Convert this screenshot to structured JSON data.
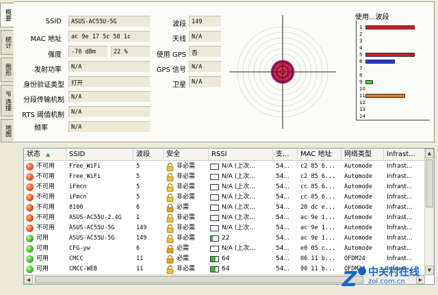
{
  "tabs": [
    "概要",
    "统计",
    "图形",
    "IP 连接",
    "地图"
  ],
  "info": {
    "ssid_label": "SSID",
    "ssid": "ASUS-AC55U-5G",
    "mac_label": "MAC 地址",
    "mac": "ac 9e 17 5c 58 1c",
    "strength_label": "强度",
    "strength_dbm": "-78 dBm",
    "strength_pct": "22 %",
    "tx_label": "发射功率",
    "tx": "N/A",
    "auth_label": "身份验证类型",
    "auth": "打开",
    "frag_label": "分段传输机制",
    "frag": "N/A",
    "rts_label": "RTS 阈值机制",
    "rts": "N/A",
    "freq_label": "频率",
    "freq": "N/A",
    "channel_label": "波段",
    "channel": "149",
    "antenna_label": "天线",
    "antenna": "N/A",
    "gps_label": "使用 GPS",
    "gps": "否",
    "gps_signal_label": "GPS 信号",
    "gps_signal": "N/A",
    "satellite_label": "卫星",
    "satellite": "N/A"
  },
  "band_chart": {
    "title": "使用...波段",
    "channels": [
      "1",
      "2",
      "3",
      "4",
      "5",
      "6",
      "7",
      "8",
      "9",
      "10",
      "11",
      "12",
      "13",
      "14"
    ],
    "bars": [
      {
        "channel": 1,
        "level": 1.0,
        "color": "#cc1f1f"
      },
      {
        "channel": 5,
        "level": 1.0,
        "color": "#cc1f1f"
      },
      {
        "channel": 6,
        "level": 0.6,
        "color": "#1f3fcc"
      },
      {
        "channel": 9,
        "level": 0.15,
        "color": "#45cc45"
      },
      {
        "channel": 11,
        "level": 0.8,
        "color": "#e07a2a"
      }
    ]
  },
  "table": {
    "headers": [
      "状态",
      "SSID",
      "波段",
      "安全",
      "RSSI",
      "支...",
      "MAC 地址",
      "网络类型",
      "Infrast..."
    ],
    "rows": [
      {
        "status": "不可用",
        "ok": false,
        "ssid": "Free_WiFi",
        "channel": "5",
        "security": "非必需",
        "secured": false,
        "rssi": "N/A (上次...",
        "sig": 0,
        "rate": "54...",
        "mac": "c2 85 6...",
        "net": "Automode",
        "infra": "Infrast..."
      },
      {
        "status": "不可用",
        "ok": false,
        "ssid": "Free_WiFi",
        "channel": "5",
        "security": "非必需",
        "secured": false,
        "rssi": "N/A (上次...",
        "sig": 0,
        "rate": "54...",
        "mac": "c2 85 6...",
        "net": "Automode",
        "infra": "Infrast..."
      },
      {
        "status": "不可用",
        "ok": false,
        "ssid": "iFmcn",
        "channel": "5",
        "security": "非必需",
        "secured": false,
        "rssi": "N/A (上次...",
        "sig": 0,
        "rate": "54...",
        "mac": "cc 85 6...",
        "net": "Automode",
        "infra": "Infrast..."
      },
      {
        "status": "不可用",
        "ok": false,
        "ssid": "iFmcn",
        "channel": "5",
        "security": "非必需",
        "secured": false,
        "rssi": "N/A (上次...",
        "sig": 0,
        "rate": "54...",
        "mac": "cc 85 6...",
        "net": "Automode",
        "infra": "Infrast..."
      },
      {
        "status": "不可用",
        "ok": false,
        "ssid": "8100",
        "channel": "6",
        "security": "必需",
        "secured": true,
        "rssi": "N/A (上次...",
        "sig": 0,
        "rate": "54...",
        "mac": "20 dc e...",
        "net": "Automode",
        "infra": "Infrast..."
      },
      {
        "status": "不可用",
        "ok": false,
        "ssid": "ASUS-AC55U-2.4G",
        "channel": "1",
        "security": "非必需",
        "secured": false,
        "rssi": "N/A (上次...",
        "sig": 0,
        "rate": "54...",
        "mac": "ac 9e 1...",
        "net": "Automode",
        "infra": "Infrast..."
      },
      {
        "status": "不可用",
        "ok": false,
        "ssid": "ASUS-AC55U-5G",
        "channel": "149",
        "security": "非必需",
        "secured": false,
        "rssi": "N/A (上次...",
        "sig": 0,
        "rate": "54...",
        "mac": "ac 9e 1...",
        "net": "Automode",
        "infra": "Infrast..."
      },
      {
        "status": "可用",
        "ok": true,
        "ssid": "ASUS-AC55U-5G",
        "channel": "149",
        "security": "非必需",
        "secured": false,
        "rssi": "22",
        "sig": 0.25,
        "rate": "54...",
        "mac": "ac 9e 1...",
        "net": "Automode",
        "infra": "Infrast..."
      },
      {
        "status": "可用",
        "ok": true,
        "ssid": "CFG-yw",
        "channel": "6",
        "security": "必需",
        "secured": true,
        "rssi": "N/A (上次...",
        "sig": 0,
        "rate": "54...",
        "mac": "e0 05 c...",
        "net": "Automode",
        "infra": "Infrast..."
      },
      {
        "status": "可用",
        "ok": true,
        "ssid": "CMCC",
        "channel": "11",
        "security": "必需",
        "secured": true,
        "rssi": "64",
        "sig": 0.6,
        "rate": "54...",
        "mac": "06 11 b...",
        "net": "OFDM24",
        "infra": "Infrast..."
      },
      {
        "status": "可用",
        "ok": true,
        "ssid": "CMCC-WEB",
        "channel": "11",
        "security": "非必需",
        "secured": false,
        "rssi": "64",
        "sig": 0.6,
        "rate": "54...",
        "mac": "00 11 b...",
        "net": "OFDM24",
        "infra": "Infrast..."
      },
      {
        "status": "不可用",
        "ok": false,
        "ssid": "D-Link_DIR-600M",
        "channel": "11",
        "security": "非必需",
        "secured": false,
        "rssi": "N/A (上次...",
        "sig": 0,
        "rate": "54...",
        "mac": "5c d9 5...",
        "net": "Automode",
        "infra": "Infrast..."
      }
    ]
  },
  "watermark": {
    "name": "中关村在线",
    "url": "zol.com.cn",
    "logo": "ZOL"
  }
}
